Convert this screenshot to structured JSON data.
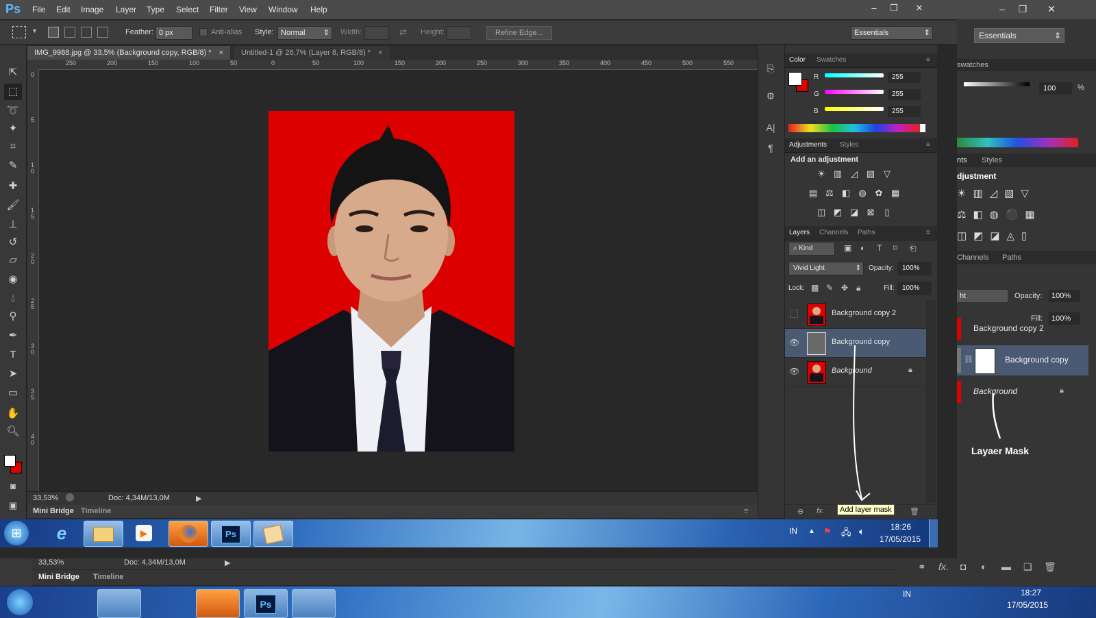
{
  "back": {
    "workspace": "Essentials",
    "swatches_tab": "swatches",
    "opacity_value": "100",
    "opacity_unit": "%",
    "adj_tab_fragment": "nts",
    "styles_tab": "Styles",
    "adjustment_fragment": "djustment",
    "channels_tab": "Channels",
    "paths_tab": "Paths",
    "blend_fragment": "ht",
    "opacity_label": "Opacity:",
    "opacity": "100%",
    "fill_label": "Fill:",
    "fill": "100%",
    "layers": [
      {
        "name": "Background copy 2"
      },
      {
        "name": "Background copy"
      },
      {
        "name": "Background"
      }
    ],
    "annotation": "Layaer Mask",
    "zoom": "33,53%",
    "doc_size": "Doc: 4,34M/13,0M",
    "tab_mini_bridge": "Mini Bridge",
    "tab_timeline": "Timeline",
    "lang": "IN",
    "time": "18:27",
    "date": "17/05/2015"
  },
  "app": {
    "logo": "Ps",
    "menu": [
      "File",
      "Edit",
      "Image",
      "Layer",
      "Type",
      "Select",
      "Filter",
      "View",
      "Window",
      "Help"
    ],
    "workspace": "Essentials"
  },
  "options": {
    "feather_label": "Feather:",
    "feather_value": "0 px",
    "antialias_label": "Anti-alias",
    "style_label": "Style:",
    "style_value": "Normal",
    "width_label": "Width:",
    "height_label": "Height:",
    "refine_edge": "Refine Edge..."
  },
  "documents": [
    {
      "title": "IMG_9988.jpg @ 33,5% (Background copy, RGB/8) *",
      "close": "×"
    },
    {
      "title": "Untitled-1 @ 26,7% (Layer 8, RGB/8) *",
      "close": "×"
    }
  ],
  "ruler_top": [
    "250",
    "200",
    "150",
    "100",
    "50",
    "0",
    "50",
    "100",
    "150",
    "200",
    "250",
    "300",
    "350",
    "400",
    "450",
    "500",
    "550"
  ],
  "ruler_left": [
    "0",
    "5",
    "1 0",
    "1 5",
    "2 0",
    "2 5",
    "3 0",
    "3 5",
    "4 0"
  ],
  "status": {
    "zoom": "33,53%",
    "doc_size": "Doc: 4,34M/13,0M"
  },
  "bottom_tabs": {
    "mini_bridge": "Mini Bridge",
    "timeline": "Timeline"
  },
  "color_panel": {
    "tab_color": "Color",
    "tab_swatches": "Swatches",
    "r_label": "R",
    "r": "255",
    "g_label": "G",
    "g": "255",
    "b_label": "B",
    "b": "255",
    "foreground": "#ffffff",
    "background": "#dd0000"
  },
  "adjustments_panel": {
    "tab_adjustments": "Adjustments",
    "tab_styles": "Styles",
    "heading": "Add an adjustment"
  },
  "layers_panel": {
    "tab_layers": "Layers",
    "tab_channels": "Channels",
    "tab_paths": "Paths",
    "filter_kind": "Kind",
    "blend_mode": "Vivid Light",
    "opacity_label": "Opacity:",
    "opacity": "100%",
    "lock_label": "Lock:",
    "fill_label": "Fill:",
    "fill": "100%",
    "layers": [
      {
        "name": "Background copy 2",
        "visible": false,
        "selected": false
      },
      {
        "name": "Background copy",
        "visible": true,
        "selected": true
      },
      {
        "name": "Background",
        "visible": true,
        "selected": false,
        "locked": true
      }
    ],
    "footer_link": "⊖",
    "footer_fx": "fx.",
    "tooltip": "Add layer mask"
  },
  "taskbar": {
    "lang": "IN",
    "time": "18:26",
    "date": "17/05/2015",
    "apps": [
      "internet-explorer",
      "file-explorer",
      "media-player",
      "firefox",
      "photoshop",
      "paint"
    ]
  },
  "colors": {
    "photo_red": "#dd0000",
    "selection_blue": "#4a5a72",
    "tooltip_yellow": "#ffffc8"
  }
}
